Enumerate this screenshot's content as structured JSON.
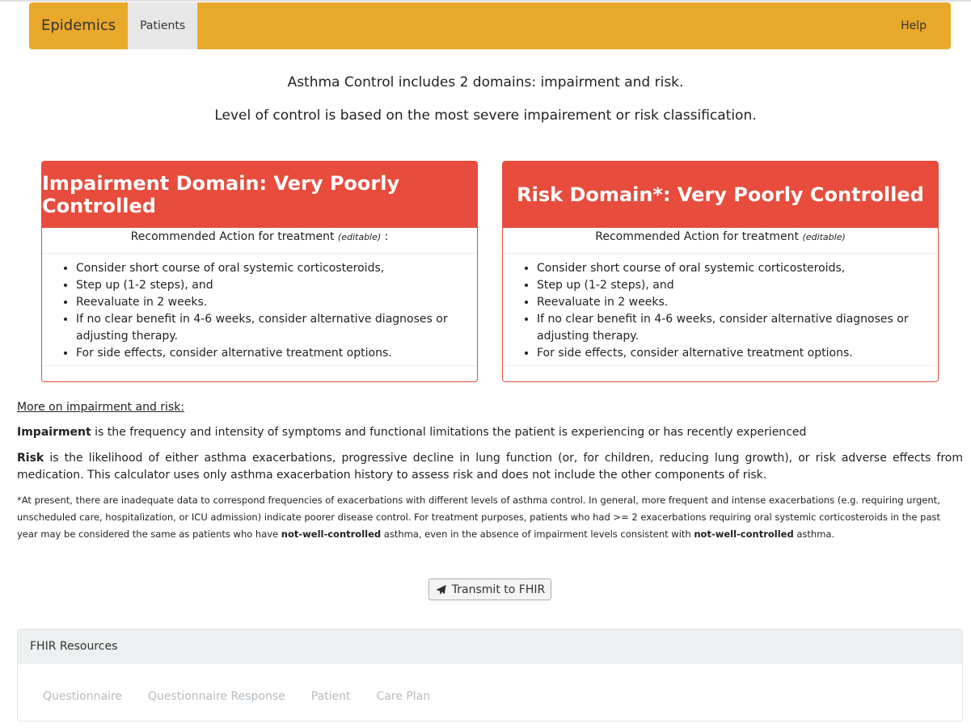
{
  "navbar": {
    "brand": "Epidemics",
    "items": [
      {
        "label": "Patients",
        "active": true
      }
    ],
    "help": "Help",
    "color": "#e8a82a"
  },
  "intro": {
    "line1": "Asthma Control includes 2 domains: impairment and risk.",
    "line2": "Level of control is based on the most severe impairement or risk classification."
  },
  "impairment": {
    "title": "Impairment Domain: Very Poorly Controlled",
    "rec_label": "Recommended Action for treatment",
    "rec_note": "(editable)",
    "rec_suffix": " :",
    "actions": [
      "Consider short course of oral systemic corticosteroids,",
      "Step up (1-2 steps), and",
      "Reevaluate in 2 weeks.",
      "If no clear benefit in 4-6 weeks, consider alternative diagnoses or adjusting therapy.",
      "For side effects, consider alternative treatment options."
    ]
  },
  "risk": {
    "title": "Risk Domain*: Very Poorly Controlled",
    "rec_label": "Recommended Action for treatment",
    "rec_note": "(editable)",
    "rec_suffix": "",
    "actions": [
      "Consider short course of oral systemic corticosteroids,",
      "Step up (1-2 steps), and",
      "Reevaluate in 2 weeks.",
      "If no clear benefit in 4-6 weeks, consider alternative diagnoses or adjusting therapy.",
      "For side effects, consider alternative treatment options."
    ]
  },
  "status_color": "#e74c3c",
  "more": {
    "link": "More on impairment and risk:",
    "impairment_term": "Impairment",
    "impairment_def": " is the frequency and intensity of symptoms and functional limitations the patient is experiencing or has recently experienced",
    "risk_term": "Risk",
    "risk_def": " is the likelihood of either asthma exacerbations, progressive decline in lung function (or, for children, reducing lung growth), or risk adverse effects from medication. This calculator uses only asthma exacerbation history to assess risk and does not include the other components of risk.",
    "note_part1": "*At present, there are inadequate data to correspond frequencies of exacerbations with different levels of asthma control. In general, more frequent and intense exacerbations (e.g. requiring urgent, unscheduled care, hospitalization, or ICU admission) indicate poorer disease control. For treatment purposes, patients who had >= 2 exacerbations requiring oral systemic corticosteroids in the past year may be considered the same as patients who have ",
    "note_bold": "not-well-controlled",
    "note_part2": " asthma, even in the absence of impairment levels consistent with ",
    "note_bold2": "not-well-controlled",
    "note_part3": " asthma."
  },
  "transmit": {
    "label": "Transmit to FHIR",
    "icon": "send-icon"
  },
  "fhir": {
    "heading": "FHIR Resources",
    "tabs": [
      "Questionnaire",
      "Questionnaire Response",
      "Patient",
      "Care Plan"
    ]
  }
}
